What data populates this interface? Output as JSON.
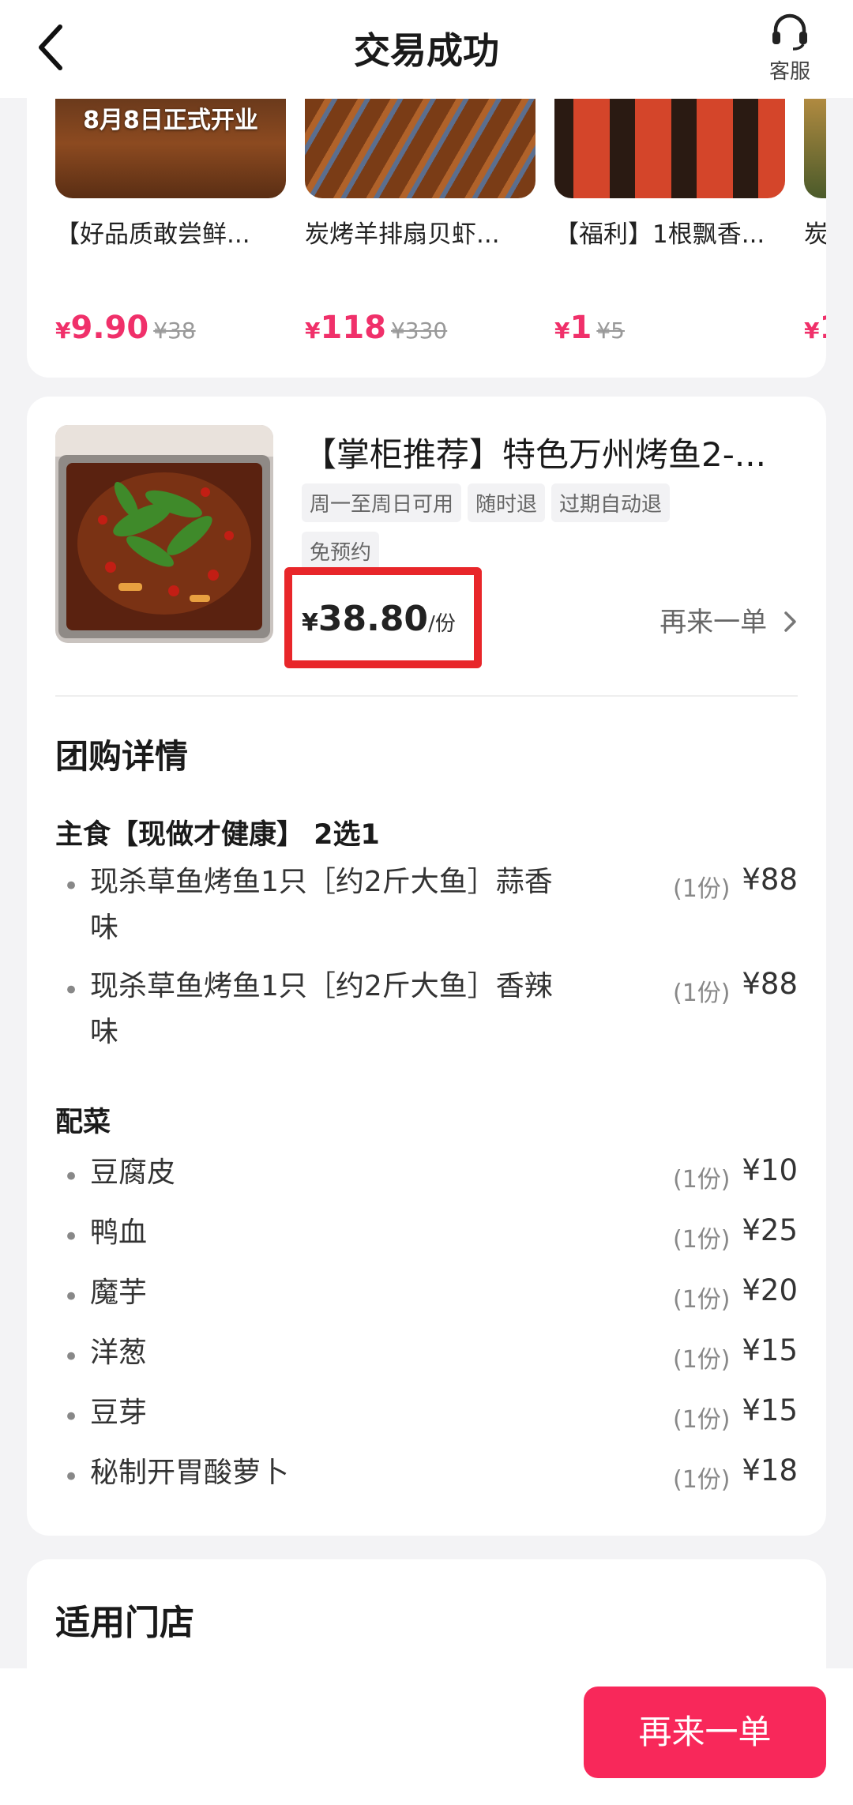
{
  "header": {
    "title": "交易成功",
    "service_label": "客服"
  },
  "recommendations": [
    {
      "banner": "8月8日正式开业",
      "name": "【好品质敢尝鲜...",
      "price": "9.90",
      "original": "¥38"
    },
    {
      "banner": "",
      "name": "炭烤羊排扇贝虾...",
      "price": "118",
      "original": "¥330"
    },
    {
      "banner": "",
      "name": "【福利】1根飘香...",
      "price": "1",
      "original": "¥5"
    },
    {
      "banner": "",
      "name": "炭",
      "price": "1",
      "original": ""
    }
  ],
  "product": {
    "title": "【掌柜推荐】特色万州烤鱼2-...",
    "tags": [
      "周一至周日可用",
      "随时退",
      "过期自动退",
      "免预约"
    ],
    "price_currency": "¥",
    "price": "38.80",
    "price_unit": "/份",
    "reorder_link": "再来一单"
  },
  "details": {
    "title": "团购详情",
    "groups": [
      {
        "title": "主食【现做才健康】 2选1",
        "items": [
          {
            "name": "现杀草鱼烤鱼1只［约2斤大鱼］蒜香味",
            "qty": "(1份)",
            "price": "¥88"
          },
          {
            "name": "现杀草鱼烤鱼1只［约2斤大鱼］香辣味",
            "qty": "(1份)",
            "price": "¥88"
          }
        ]
      },
      {
        "title": "配菜",
        "items": [
          {
            "name": "豆腐皮",
            "qty": "(1份)",
            "price": "¥10"
          },
          {
            "name": "鸭血",
            "qty": "(1份)",
            "price": "¥25"
          },
          {
            "name": "魔芋",
            "qty": "(1份)",
            "price": "¥20"
          },
          {
            "name": "洋葱",
            "qty": "(1份)",
            "price": "¥15"
          },
          {
            "name": "豆芽",
            "qty": "(1份)",
            "price": "¥15"
          },
          {
            "name": "秘制开胃酸萝卜",
            "qty": "(1份)",
            "price": "¥18"
          }
        ]
      }
    ]
  },
  "store": {
    "title": "适用门店"
  },
  "bottom": {
    "reorder_button": "再来一单"
  },
  "colors": {
    "accent": "#f8285a",
    "price_red": "#f0306a",
    "highlight_box": "#e8262a"
  },
  "icons": {
    "back": "chevron-left-icon",
    "service": "headset-icon",
    "arrow": "chevron-right-icon"
  }
}
